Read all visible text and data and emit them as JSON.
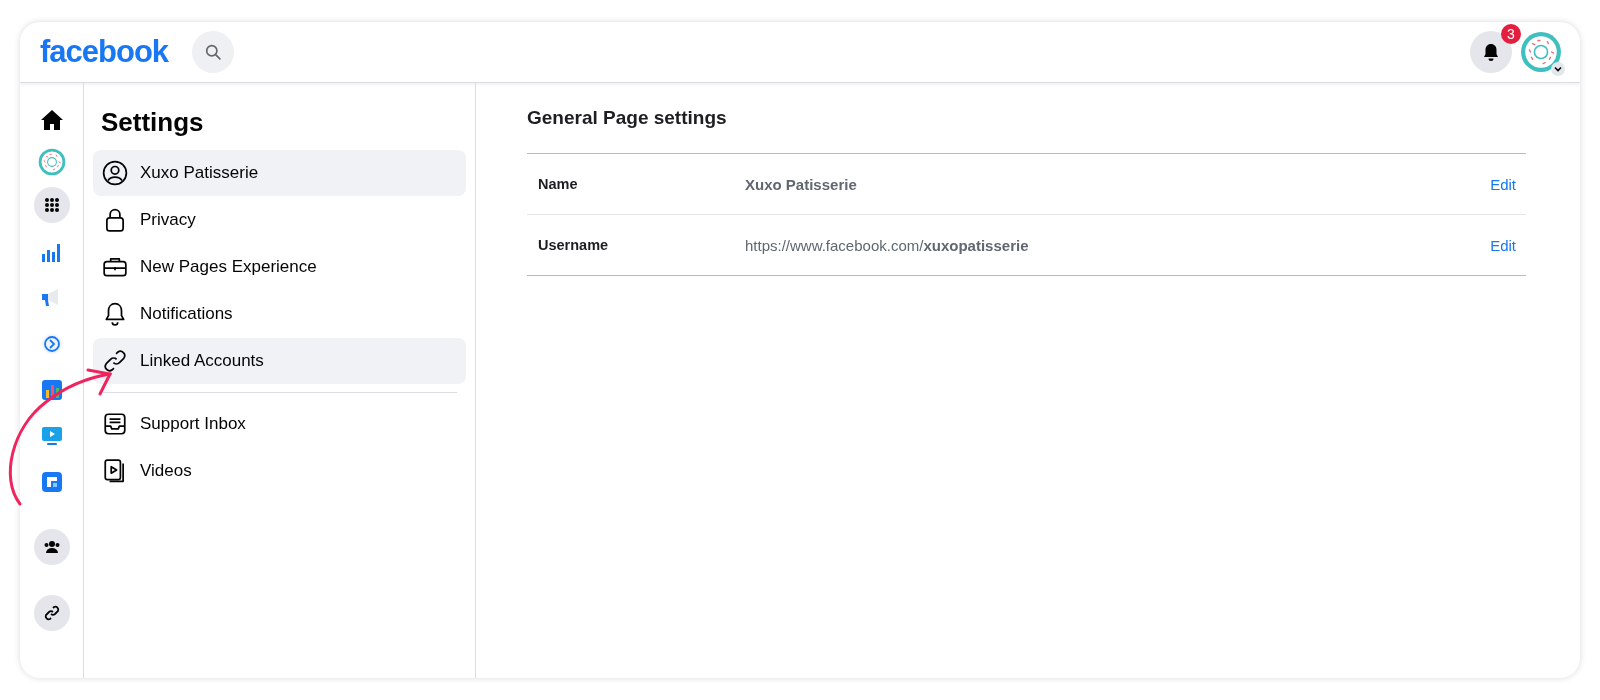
{
  "header": {
    "logo": "facebook",
    "notification_badge": "3"
  },
  "settings": {
    "title": "Settings",
    "groups": [
      [
        {
          "label": "Xuxo Patisserie",
          "selected": true
        },
        {
          "label": "Privacy",
          "selected": false
        },
        {
          "label": "New Pages Experience",
          "selected": false
        },
        {
          "label": "Notifications",
          "selected": false
        },
        {
          "label": "Linked Accounts",
          "selected": true
        }
      ],
      [
        {
          "label": "Support Inbox",
          "selected": false
        },
        {
          "label": "Videos",
          "selected": false
        }
      ]
    ]
  },
  "main": {
    "title": "General Page settings",
    "rows": [
      {
        "label": "Name",
        "value": "Xuxo Patisserie",
        "action": "Edit"
      },
      {
        "label": "Username",
        "value": "https://www.facebook.com/**xuxopatisserie**",
        "action": "Edit"
      }
    ]
  }
}
